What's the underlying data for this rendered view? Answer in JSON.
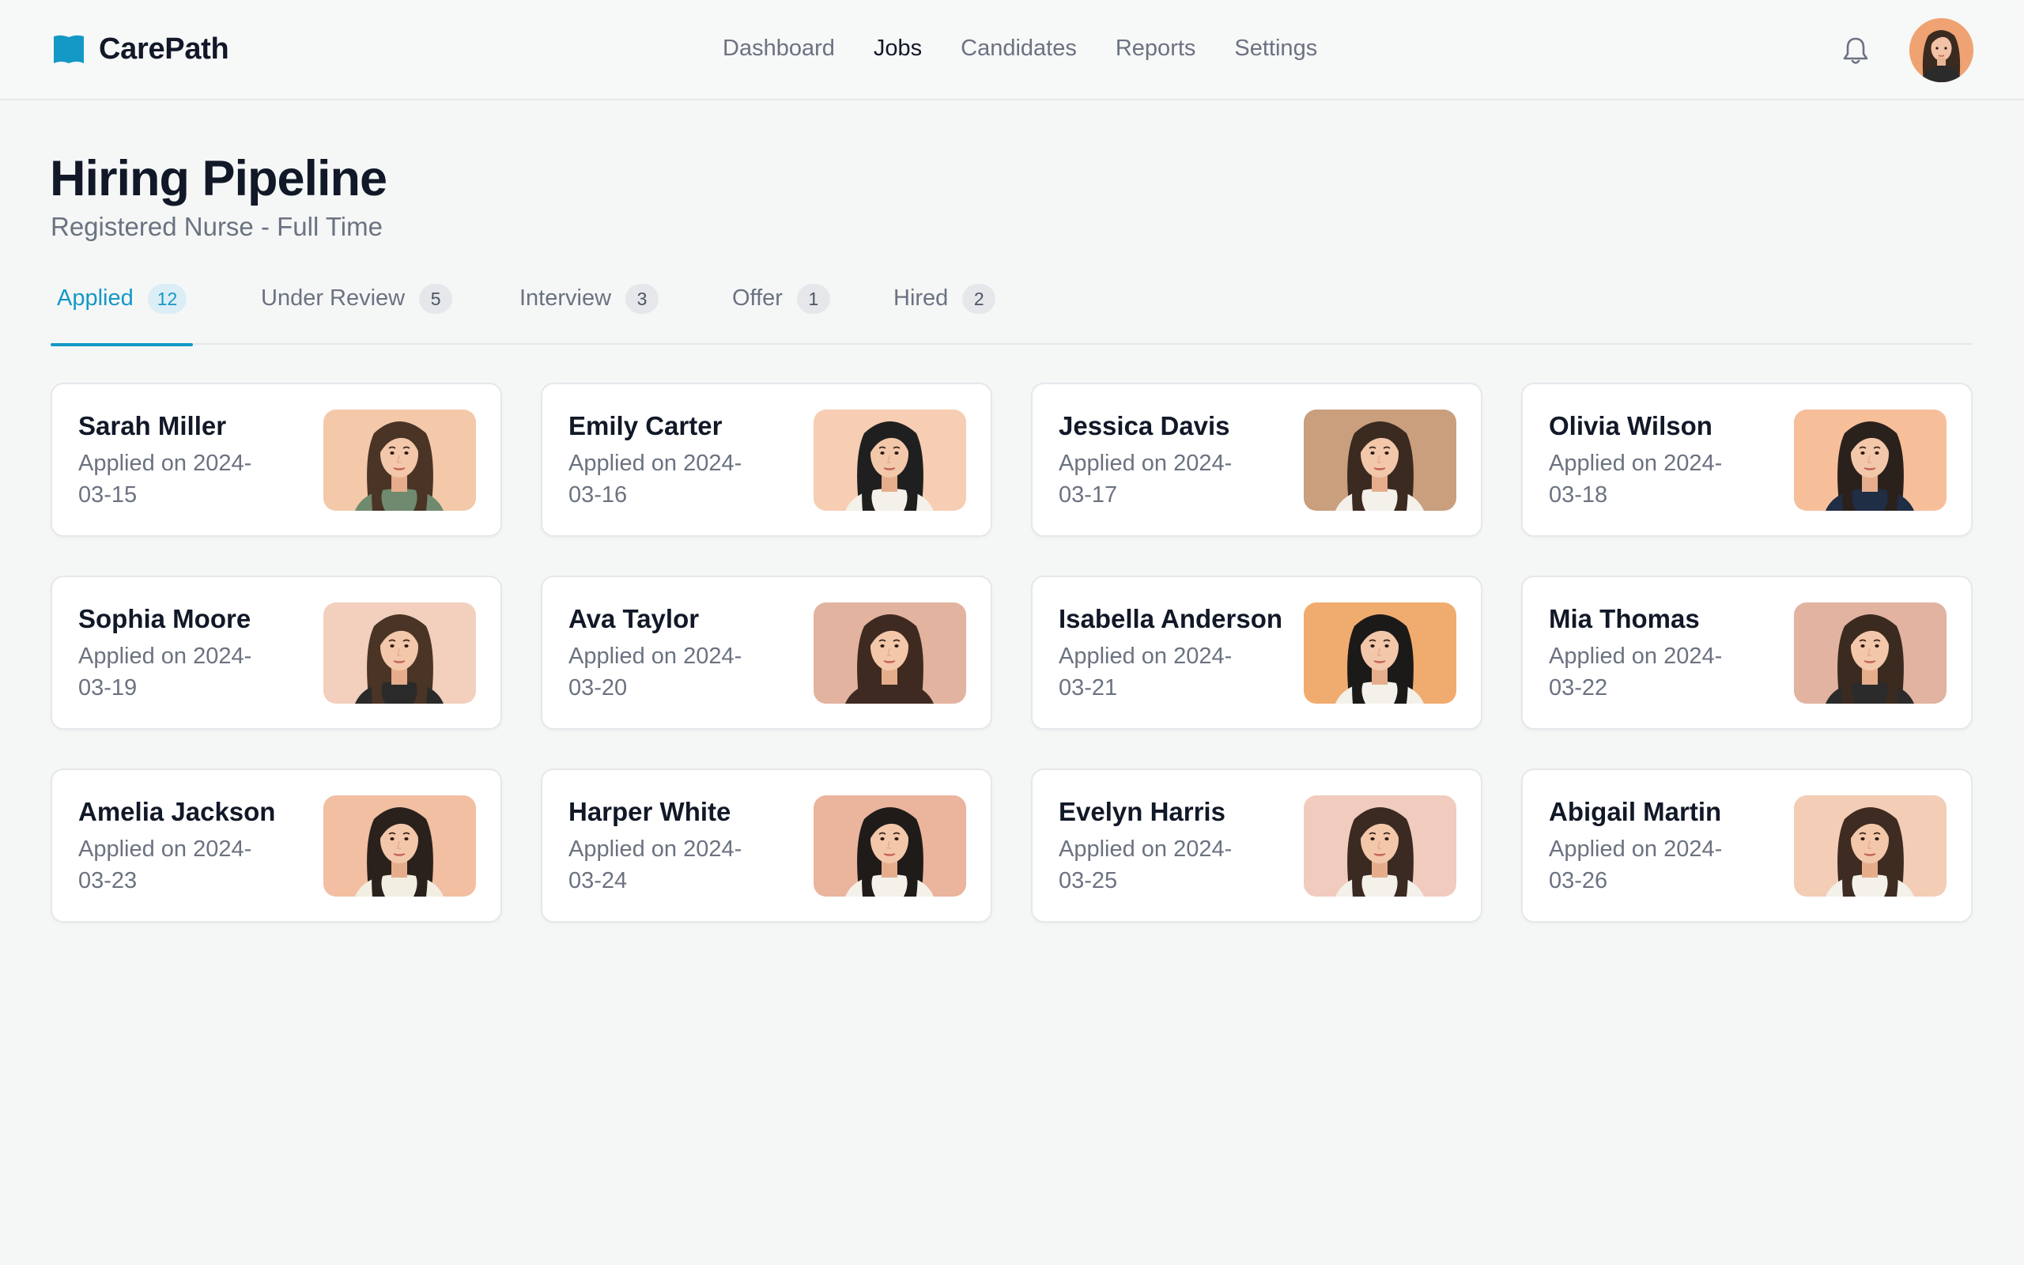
{
  "app": {
    "name": "CarePath",
    "brand_color": "#1498c6"
  },
  "nav": {
    "items": [
      {
        "label": "Dashboard",
        "active": false
      },
      {
        "label": "Jobs",
        "active": true
      },
      {
        "label": "Candidates",
        "active": false
      },
      {
        "label": "Reports",
        "active": false
      },
      {
        "label": "Settings",
        "active": false
      }
    ],
    "notification_icon": "bell-icon",
    "user_avatar": "user-avatar"
  },
  "page": {
    "title": "Hiring Pipeline",
    "subtitle": "Registered Nurse - Full Time"
  },
  "tabs": [
    {
      "label": "Applied",
      "count": "12",
      "active": true
    },
    {
      "label": "Under Review",
      "count": "5",
      "active": false
    },
    {
      "label": "Interview",
      "count": "3",
      "active": false
    },
    {
      "label": "Offer",
      "count": "1",
      "active": false
    },
    {
      "label": "Hired",
      "count": "2",
      "active": false
    }
  ],
  "candidates": [
    {
      "name": "Sarah Miller",
      "applied": "Applied on 2024-03-15",
      "photo_bg": "#f3c9a9",
      "hair": "#4a3426",
      "shirt": "#6f8a6f"
    },
    {
      "name": "Emily Carter",
      "applied": "Applied on 2024-03-16",
      "photo_bg": "#f7cdb3",
      "hair": "#1f1f1f",
      "shirt": "#f4f1ea"
    },
    {
      "name": "Jessica Davis",
      "applied": "Applied on 2024-03-17",
      "photo_bg": "#c99f7e",
      "hair": "#3b2a20",
      "shirt": "#f4f1ea"
    },
    {
      "name": "Olivia Wilson",
      "applied": "Applied on 2024-03-18",
      "photo_bg": "#f6bf9a",
      "hair": "#2b211c",
      "shirt": "#1f2d45"
    },
    {
      "name": "Sophia Moore",
      "applied": "Applied on 2024-03-19",
      "photo_bg": "#f2d0bd",
      "hair": "#4a3426",
      "shirt": "#2a2a2a"
    },
    {
      "name": "Ava Taylor",
      "applied": "Applied on 2024-03-20",
      "photo_bg": "#e2b39e",
      "hair": "#3e2a20",
      "shirt": "#3e2a20"
    },
    {
      "name": "Isabella Anderson",
      "applied": "Applied on 2024-03-21",
      "photo_bg": "#f0ac6f",
      "hair": "#1c1a19",
      "shirt": "#f4f1ea"
    },
    {
      "name": "Mia Thomas",
      "applied": "Applied on 2024-03-22",
      "photo_bg": "#e1b3a0",
      "hair": "#3b2a20",
      "shirt": "#2b2b2b"
    },
    {
      "name": "Amelia Jackson",
      "applied": "Applied on 2024-03-23",
      "photo_bg": "#f2bfa3",
      "hair": "#2a211d",
      "shirt": "#f2eee2"
    },
    {
      "name": "Harper White",
      "applied": "Applied on 2024-03-24",
      "photo_bg": "#eab49d",
      "hair": "#1f1b19",
      "shirt": "#f4f1ea"
    },
    {
      "name": "Evelyn Harris",
      "applied": "Applied on 2024-03-25",
      "photo_bg": "#f1cbbe",
      "hair": "#3a2a22",
      "shirt": "#f4f1ea"
    },
    {
      "name": "Abigail Martin",
      "applied": "Applied on 2024-03-26",
      "photo_bg": "#f3cdb6",
      "hair": "#3e2b21",
      "shirt": "#f4f1ea"
    }
  ]
}
